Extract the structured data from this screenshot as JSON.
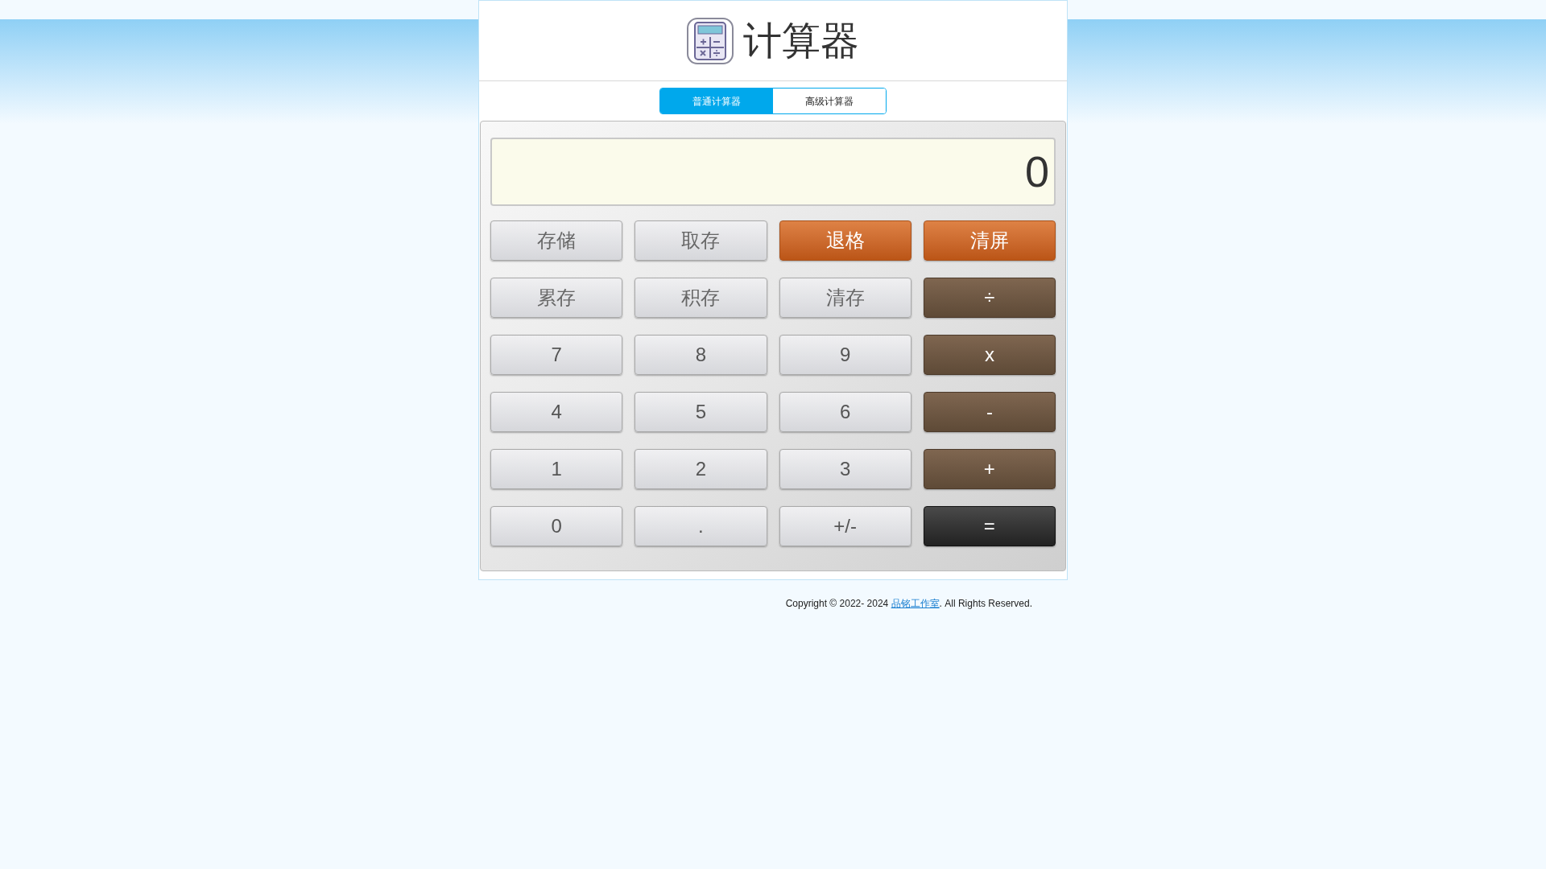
{
  "header": {
    "title": "计算器"
  },
  "tabs": [
    {
      "label": "普通计算器",
      "selected": true
    },
    {
      "label": "高级计算器",
      "selected": false
    }
  ],
  "display": {
    "value": "0"
  },
  "keys": [
    {
      "label": "存储",
      "kind": "memory"
    },
    {
      "label": "取存",
      "kind": "memory"
    },
    {
      "label": "退格",
      "kind": "clear"
    },
    {
      "label": "清屏",
      "kind": "clear"
    },
    {
      "label": "累存",
      "kind": "memory"
    },
    {
      "label": "积存",
      "kind": "memory"
    },
    {
      "label": "清存",
      "kind": "memory"
    },
    {
      "label": "÷",
      "kind": "operator"
    },
    {
      "label": "7",
      "kind": "digit"
    },
    {
      "label": "8",
      "kind": "digit"
    },
    {
      "label": "9",
      "kind": "digit"
    },
    {
      "label": "x",
      "kind": "operator"
    },
    {
      "label": "4",
      "kind": "digit"
    },
    {
      "label": "5",
      "kind": "digit"
    },
    {
      "label": "6",
      "kind": "digit"
    },
    {
      "label": "-",
      "kind": "operator"
    },
    {
      "label": "1",
      "kind": "digit"
    },
    {
      "label": "2",
      "kind": "digit"
    },
    {
      "label": "3",
      "kind": "digit"
    },
    {
      "label": "+",
      "kind": "operator"
    },
    {
      "label": "0",
      "kind": "digit"
    },
    {
      "label": ".",
      "kind": "digit"
    },
    {
      "label": "+/-",
      "kind": "digit"
    },
    {
      "label": "=",
      "kind": "equals"
    }
  ],
  "footer": {
    "prefix": "Copyright © 2022- 2024",
    "link": "品铭工作室",
    "suffix": ". All Rights Reserved."
  }
}
